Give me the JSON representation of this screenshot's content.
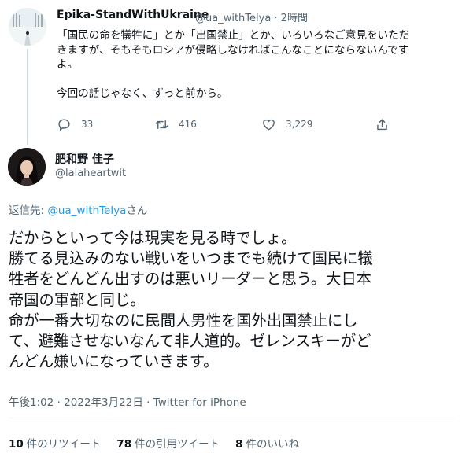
{
  "parent_tweet": {
    "display_name": "Epika-StandWithUkraine",
    "handle_time": "@ua_withTelya · 2時間",
    "text_lines": [
      "「国民の命を犠牲に」とか「出国禁止」とか、いろいろなご意見をいただ",
      "きますが、そもそもロシアが侵略しなければこんなことにならないんです",
      "よ。",
      "今回の話じゃなく、ずっと前から。"
    ],
    "actions": {
      "reply_count": "33",
      "retweet_count": "416",
      "like_count": "3,229"
    }
  },
  "main_tweet": {
    "display_name": "肥和野 佳子",
    "handle": "@lalaheartwit",
    "reply_prefix": "返信先: ",
    "reply_handle": "@ua_withTelya",
    "reply_suffix": "さん",
    "text_lines": [
      "だからといって今は現実を見る時でしょ。",
      "勝てる見込みのない戦いをいつまでも続けて国民に犠",
      "牲者をどんどん出すのは悪いリーダーと思う。大日本",
      "帝国の軍部と同じ。",
      "命が一番大切なのに民間人男性を国外出国禁止にし",
      "て、避難させないなんて非人道的。ゼレンスキーがど",
      "んどん嫌いになっていきます。"
    ],
    "meta": "午後1:02 · 2022年3月22日 · Twitter for iPhone",
    "stats": {
      "retweets_num": "10",
      "retweets_label": "件のリツイート",
      "quotes_num": "78",
      "quotes_label": "件の引用ツイート",
      "likes_num": "8",
      "likes_label": "件のいいね"
    }
  },
  "icons": [
    "reply-icon",
    "retweet-icon",
    "like-icon",
    "share-icon"
  ],
  "colors": {
    "link": "#1d9bf0",
    "secondary_text": "#536471",
    "text": "#0f1419"
  }
}
